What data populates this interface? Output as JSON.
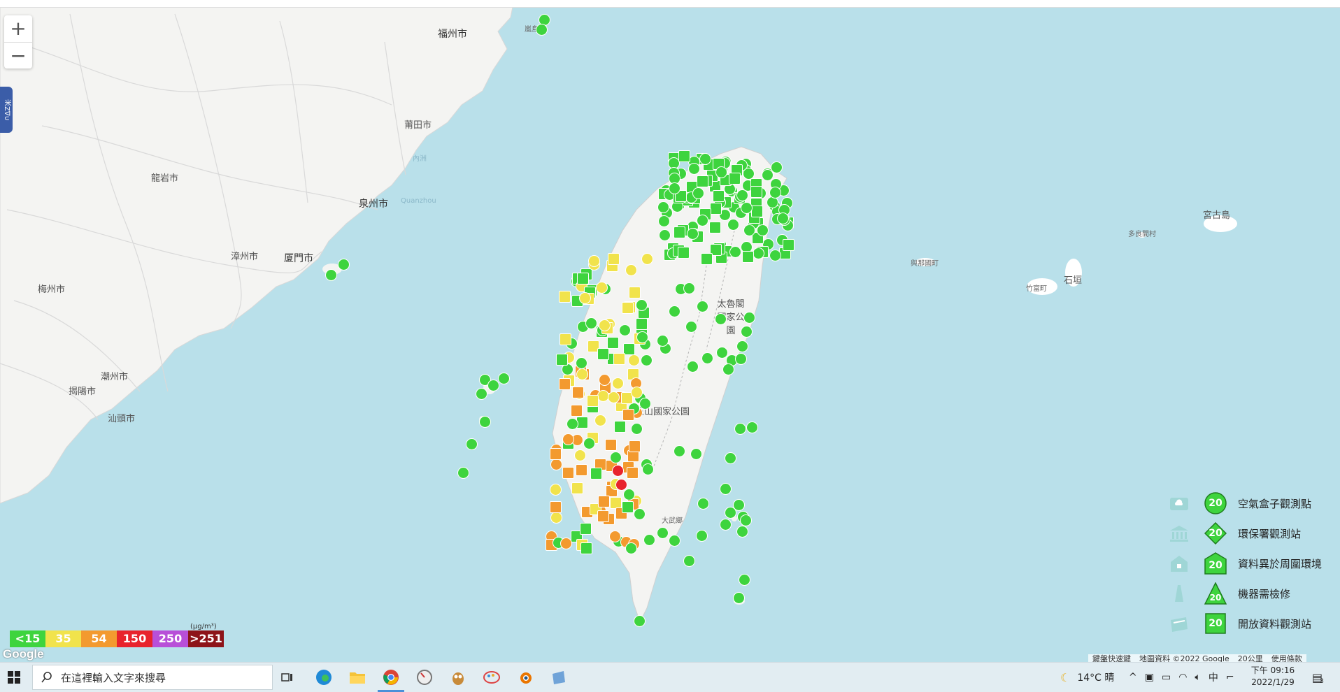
{
  "zoom": {
    "in": "+",
    "out": "−"
  },
  "side_tab": "米Z∇∪",
  "map_labels": [
    {
      "text": "福州市",
      "cls": "big"
    },
    {
      "text": "莆田市",
      "cls": ""
    },
    {
      "text": "泉州市",
      "cls": "big"
    },
    {
      "text": "厦門市",
      "cls": "big"
    },
    {
      "text": "漳州市",
      "cls": ""
    },
    {
      "text": "龍岩市",
      "cls": ""
    },
    {
      "text": "梅州市",
      "cls": ""
    },
    {
      "text": "潮州市",
      "cls": ""
    },
    {
      "text": "揭陽市",
      "cls": ""
    },
    {
      "text": "汕頭市",
      "cls": ""
    },
    {
      "text": "太魯閣國家公園",
      "cls": ""
    },
    {
      "text": "玉山國家公園",
      "cls": ""
    },
    {
      "text": "大武鄉",
      "cls": "small"
    },
    {
      "text": "與那國町",
      "cls": "small"
    },
    {
      "text": "竹富町",
      "cls": "small"
    },
    {
      "text": "石垣",
      "cls": ""
    },
    {
      "text": "宮古島",
      "cls": ""
    },
    {
      "text": "多良間村",
      "cls": "small"
    },
    {
      "text": "Quanzhou",
      "cls": "small"
    },
    {
      "text": "嵐島",
      "cls": "small"
    },
    {
      "text": "內洲",
      "cls": "small"
    }
  ],
  "scale": {
    "unit": "(μg/m³)",
    "items": [
      {
        "label": "<15",
        "color": "#3ed43e"
      },
      {
        "label": "35",
        "color": "#f1e34c"
      },
      {
        "label": "54",
        "color": "#f39a2f"
      },
      {
        "label": "150",
        "color": "#e8232c"
      },
      {
        "label": "250",
        "color": "#b84fd8"
      },
      {
        "label": ">251",
        "color": "#8d1419"
      }
    ]
  },
  "google_logo": "Google",
  "legend": [
    {
      "label": "空氣盒子觀測點",
      "value": "20",
      "shape": "circle",
      "icon": "cloud-box-icon"
    },
    {
      "label": "環保署觀測站",
      "value": "20",
      "shape": "diamond",
      "icon": "government-building-icon"
    },
    {
      "label": "資料異於周圍環境",
      "value": "20",
      "shape": "house",
      "icon": "house-icon"
    },
    {
      "label": "機器需檢修",
      "value": "20",
      "shape": "triangle",
      "icon": "lighthouse-icon"
    },
    {
      "label": "開放資料觀測站",
      "value": "20",
      "shape": "square",
      "icon": "open-box-icon"
    }
  ],
  "attribution": {
    "shortcuts": "鍵盤快速鍵",
    "mapdata": "地圖資料 ©2022 Google",
    "scale": "20公里",
    "terms": "使用條款"
  },
  "taskbar": {
    "search_placeholder": "在這裡輸入文字來搜尋",
    "weather": "14°C 晴",
    "ime": "中",
    "time": "下午 09:16",
    "date": "2022/1/29",
    "notifications": "3"
  },
  "marker_colors": {
    "green": "#3ed43e",
    "yellow": "#f1e34c",
    "orange": "#f39a2f",
    "red": "#e8232c"
  }
}
